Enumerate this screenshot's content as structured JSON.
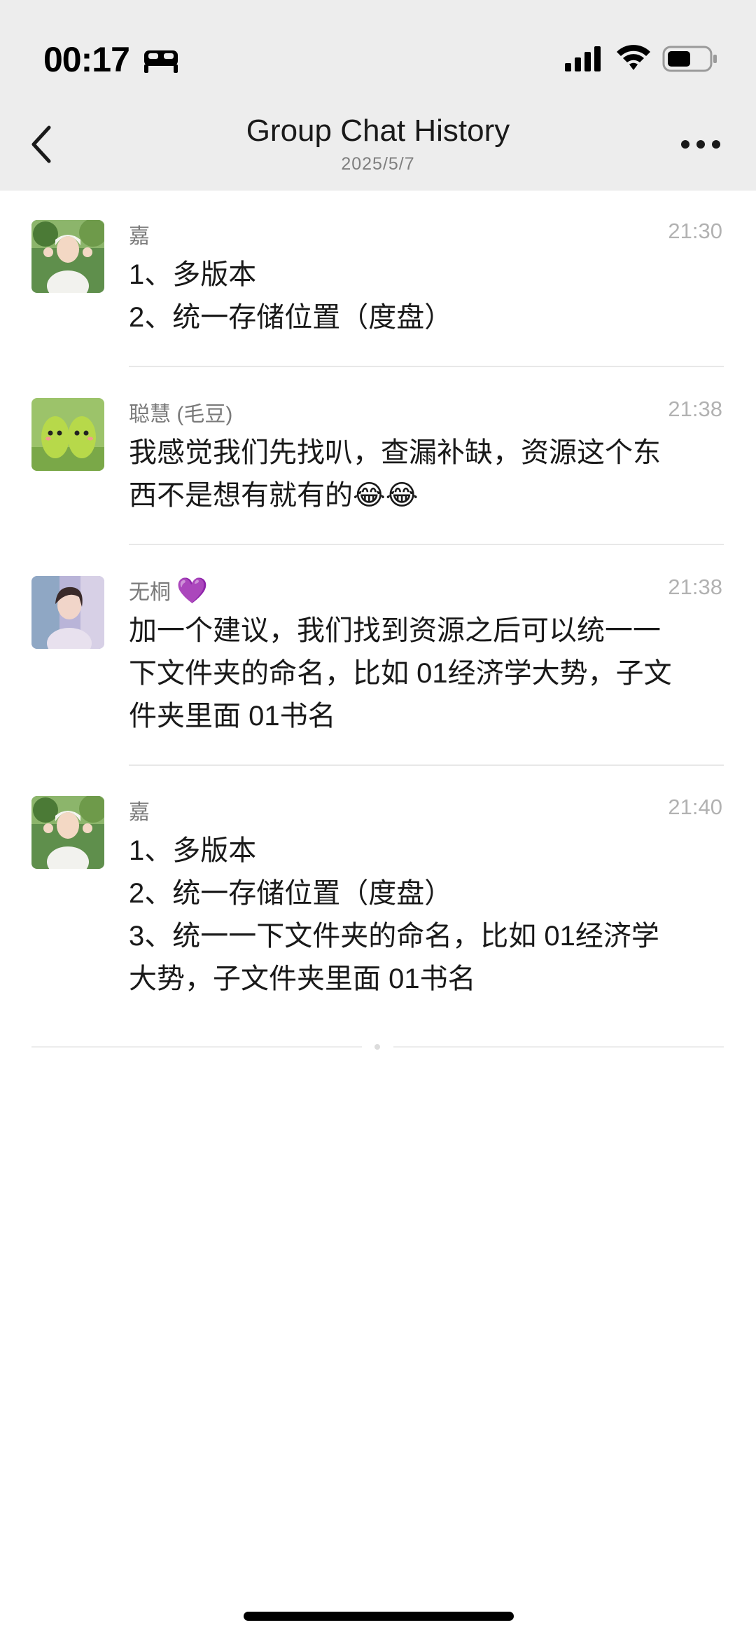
{
  "status_bar": {
    "time": "00:17"
  },
  "nav": {
    "title": "Group Chat History",
    "subtitle": "2025/5/7"
  },
  "messages": [
    {
      "sender": "嘉",
      "time": "21:30",
      "lines": [
        "1、多版本",
        "2、统一存储位置（度盘）"
      ]
    },
    {
      "sender": "聪慧 (毛豆)",
      "time": "21:38",
      "lines": [
        "我感觉我们先找叭，查漏补缺，资源这个东",
        "西不是想有就有的😂😂"
      ]
    },
    {
      "sender": "无桐",
      "sender_emoji": "💜",
      "time": "21:38",
      "lines": [
        "加一个建议，我们找到资源之后可以统一一",
        "下文件夹的命名，比如 01经济学大势，子文",
        "件夹里面 01书名"
      ]
    },
    {
      "sender": "嘉",
      "time": "21:40",
      "lines": [
        "1、多版本",
        "2、统一存储位置（度盘）",
        "3、统一一下文件夹的命名，比如 01经济学",
        "大势，子文件夹里面 01书名"
      ]
    }
  ],
  "colors": {
    "nav_bg": "#ededed",
    "text": "#191919",
    "meta": "#7a7a7a",
    "time": "#b2b2b2"
  }
}
